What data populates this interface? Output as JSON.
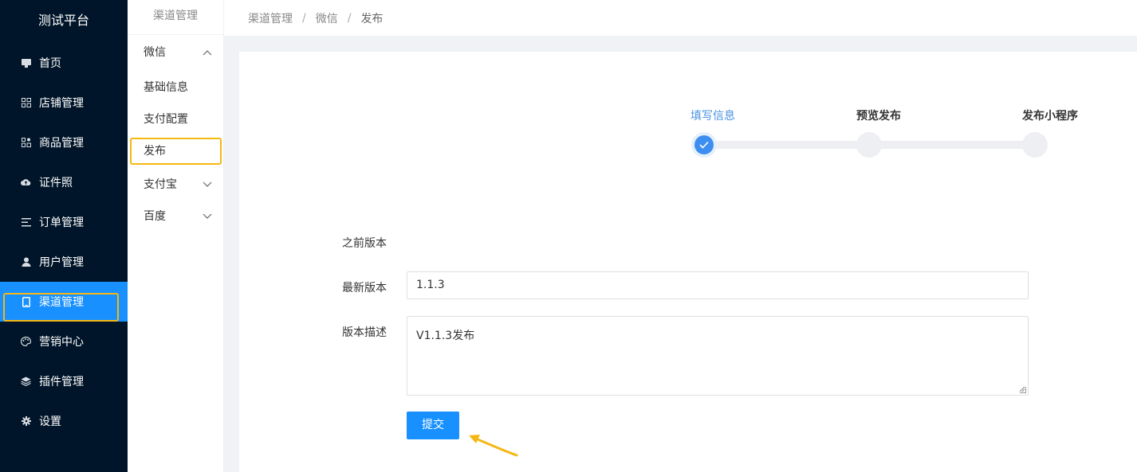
{
  "app": {
    "title": "测试平台"
  },
  "sidebar": {
    "items": [
      {
        "label": "首页",
        "icon": "monitor-icon"
      },
      {
        "label": "店铺管理",
        "icon": "store-icon"
      },
      {
        "label": "商品管理",
        "icon": "apps-icon"
      },
      {
        "label": "证件照",
        "icon": "cloud-icon"
      },
      {
        "label": "订单管理",
        "icon": "list-icon"
      },
      {
        "label": "用户管理",
        "icon": "user-icon"
      },
      {
        "label": "渠道管理",
        "icon": "mobile-icon",
        "active": true
      },
      {
        "label": "营销中心",
        "icon": "palette-icon"
      },
      {
        "label": "插件管理",
        "icon": "layers-icon"
      },
      {
        "label": "设置",
        "icon": "gear-icon"
      }
    ],
    "accent_color": "#1890ff",
    "background_color": "#001529"
  },
  "submenu": {
    "title": "渠道管理",
    "groups": [
      {
        "label": "微信",
        "expanded": true,
        "children": [
          "基础信息",
          "支付配置",
          "发布"
        ]
      },
      {
        "label": "支付宝",
        "expanded": false
      },
      {
        "label": "百度",
        "expanded": false
      }
    ]
  },
  "breadcrumb": [
    "渠道管理",
    "微信",
    "发布"
  ],
  "steps": [
    {
      "label": "填写信息",
      "status": "done"
    },
    {
      "label": "预览发布",
      "status": "wait"
    },
    {
      "label": "发布小程序",
      "status": "wait"
    }
  ],
  "form": {
    "prev_version_label": "之前版本",
    "prev_version_value": "",
    "latest_version_label": "最新版本",
    "latest_version_value": "1.1.3",
    "description_label": "版本描述",
    "description_value": "V1.1.3发布",
    "submit_label": "提交"
  },
  "highlight_color": "#f5b813"
}
